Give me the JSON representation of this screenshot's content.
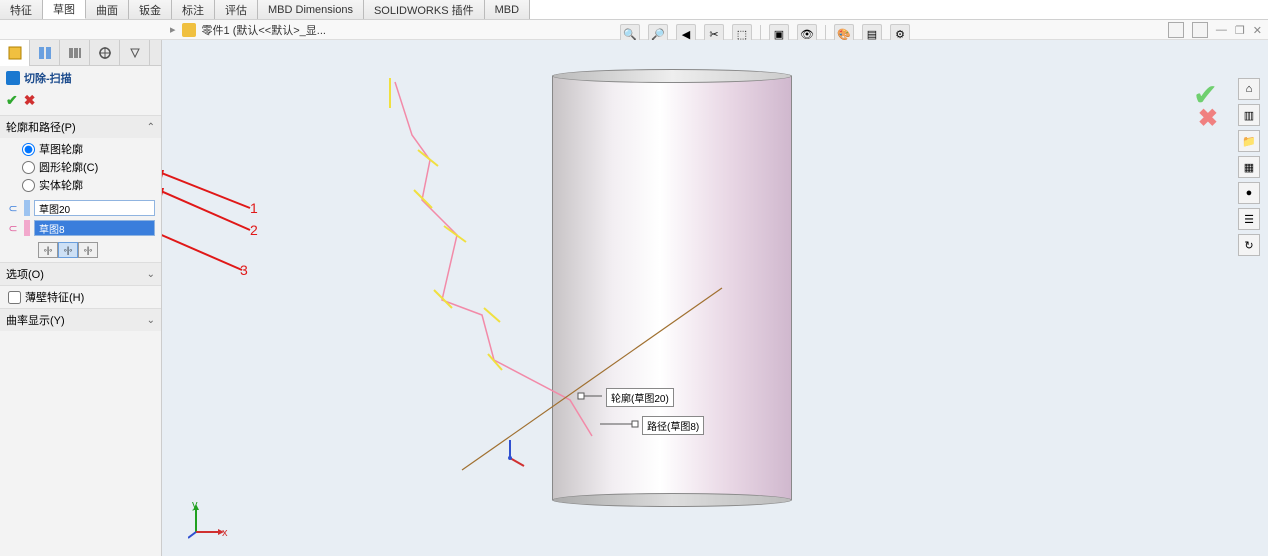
{
  "tabs": [
    "特征",
    "草图",
    "曲面",
    "钣金",
    "标注",
    "评估",
    "MBD Dimensions",
    "SOLIDWORKS 插件",
    "MBD"
  ],
  "active_tab_index": 1,
  "breadcrumb": "零件1 (默认<<默认>_显...",
  "feature_title": "切除-扫描",
  "sections": {
    "profile_path_hdr": "轮廓和路径(P)",
    "radio_sketch_profile": "草图轮廓",
    "radio_circular_profile": "圆形轮廓(C)",
    "radio_solid_profile": "实体轮廓",
    "profile_value": "草图20",
    "path_value": "草图8",
    "options_hdr": "选项(O)",
    "thin_feature_label": "薄壁特征(H)",
    "curvature_hdr": "曲率显示(Y)"
  },
  "callouts": {
    "profile": "轮廓(草图20)",
    "path": "路径(草图8)"
  },
  "annotations": {
    "n1": "1",
    "n2": "2",
    "n3": "3"
  }
}
